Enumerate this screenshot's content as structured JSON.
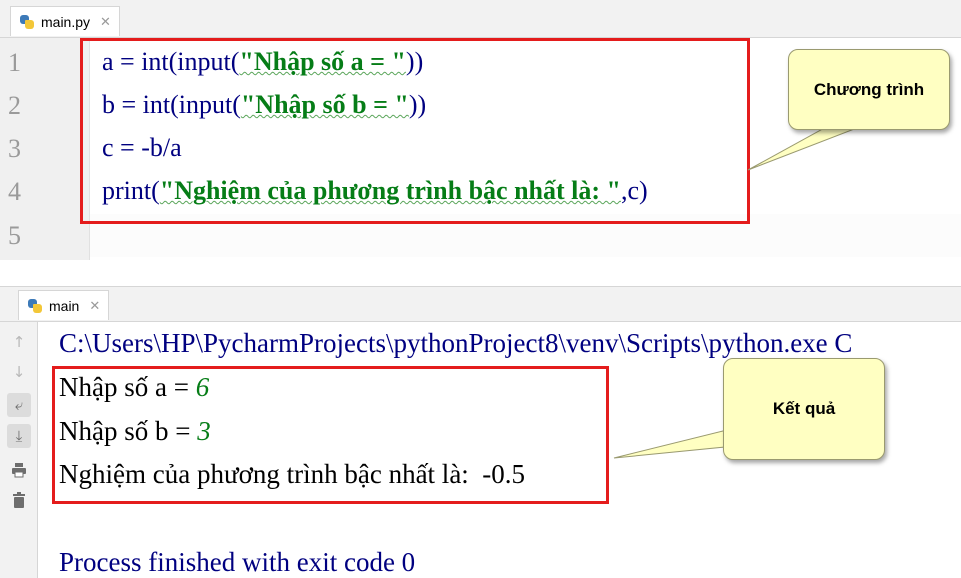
{
  "editor_tab": {
    "label": "main.py",
    "icon": "python-file-icon"
  },
  "editor": {
    "line_numbers": [
      "1",
      "2",
      "3",
      "4",
      "5"
    ],
    "lines": [
      {
        "prefix": "a = int(input(",
        "string": "\"Nhập số a = \"",
        "suffix": "))"
      },
      {
        "prefix": "b = int(input(",
        "string": "\"Nhập số b = \"",
        "suffix": "))"
      },
      {
        "prefix": "c = -b/a",
        "string": "",
        "suffix": ""
      },
      {
        "prefix": "print(",
        "string": "\"Nghiệm của phương trình bậc nhất là: \"",
        "suffix": ",c)"
      }
    ]
  },
  "run_tab": {
    "label": "main",
    "icon": "python-icon"
  },
  "toolbar": [
    "up-arrow-icon",
    "down-arrow-icon",
    "soft-wrap-icon",
    "scroll-to-end-icon",
    "print-icon",
    "trash-icon"
  ],
  "console": {
    "path": "C:\\Users\\HP\\PycharmProjects\\pythonProject8\\venv\\Scripts\\python.exe C",
    "prompt_a": "Nhập số a = ",
    "input_a": "6",
    "prompt_b": "Nhập số b = ",
    "input_b": "3",
    "result": "Nghiệm của phương trình bậc nhất là:  -0.5",
    "exit": "Process finished with exit code 0"
  },
  "callouts": {
    "program": "Chương trình",
    "result": "Kết quả"
  },
  "colors": {
    "keyword_blue": "#000080",
    "string_green": "#067d17",
    "annotation_red": "#e41c1c",
    "callout_fill": "#ffffc2"
  }
}
